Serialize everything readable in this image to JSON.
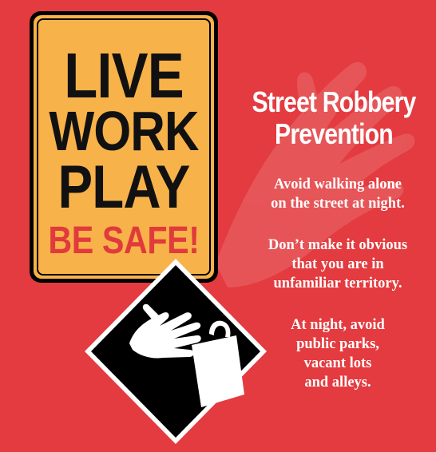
{
  "sign": {
    "line1": "LIVE",
    "line2": "WORK",
    "line3": "PLAY",
    "line4": "BE SAFE!"
  },
  "headline": {
    "line1": "Street Robbery",
    "line2": "Prevention"
  },
  "tips": [
    [
      "Avoid walking alone",
      "on the street at night."
    ],
    [
      "Don’t make it obvious",
      "that you are in",
      "unfamiliar territory."
    ],
    [
      "At night, avoid",
      "public parks,",
      "vacant lots",
      "and alleys."
    ]
  ],
  "icons": {
    "background": "hand-watermark-icon",
    "diamond": "hand-grabbing-bag-icon"
  },
  "colors": {
    "background": "#e33b3f",
    "sign_yellow": "#f8b24a",
    "sign_red_text": "#e03a3c",
    "text_white": "#ffffff",
    "black": "#000000"
  }
}
